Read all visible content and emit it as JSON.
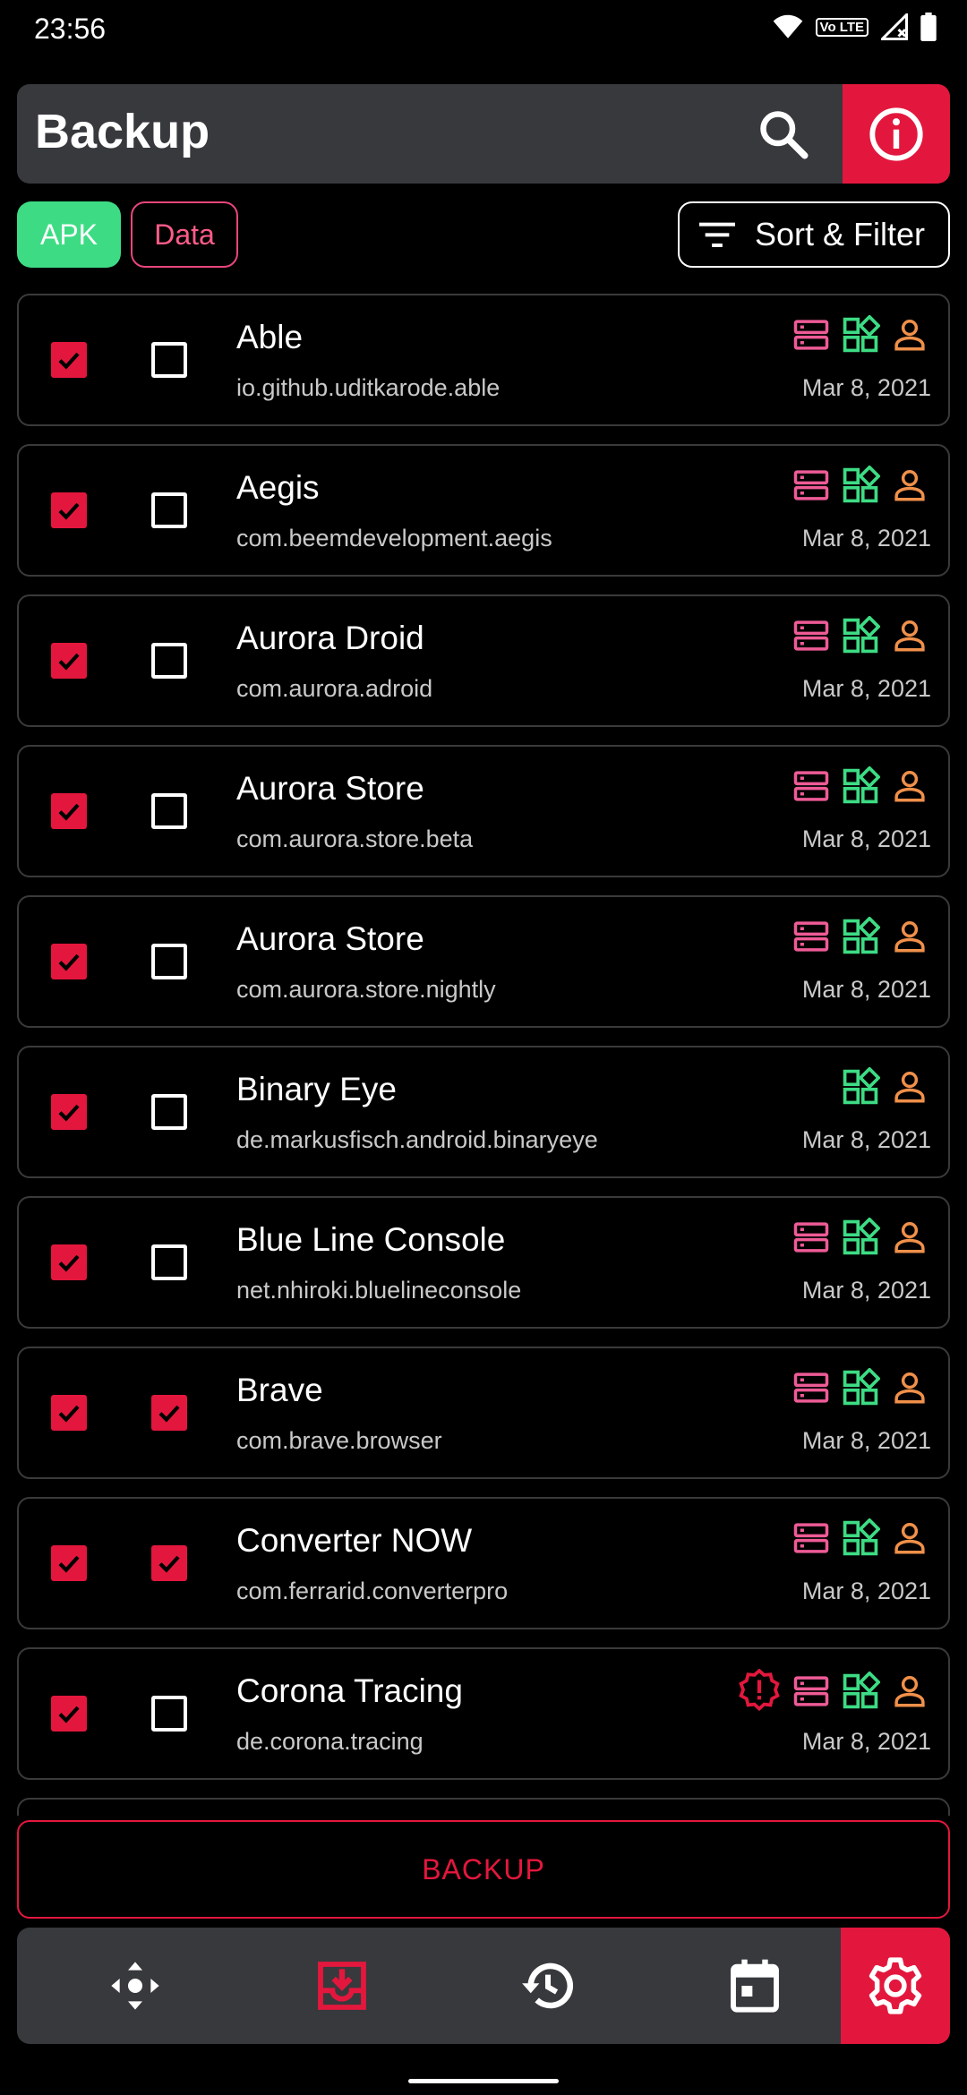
{
  "status_bar": {
    "time": "23:56",
    "volte": "Vo LTE"
  },
  "header": {
    "title": "Backup"
  },
  "chips": {
    "apk": "APK",
    "data": "Data"
  },
  "sort_filter": {
    "label": "Sort & Filter"
  },
  "colors": {
    "accent": "#e3173d",
    "green": "#3ddc84",
    "pink": "#ee5b96",
    "orange": "#f0904a"
  },
  "apps": [
    {
      "name": "Able",
      "package": "io.github.uditkarode.able",
      "date": "Mar 8, 2021",
      "apk": true,
      "data": false,
      "has_storage": true,
      "warning": false
    },
    {
      "name": "Aegis",
      "package": "com.beemdevelopment.aegis",
      "date": "Mar 8, 2021",
      "apk": true,
      "data": false,
      "has_storage": true,
      "warning": false
    },
    {
      "name": "Aurora Droid",
      "package": "com.aurora.adroid",
      "date": "Mar 8, 2021",
      "apk": true,
      "data": false,
      "has_storage": true,
      "warning": false
    },
    {
      "name": "Aurora Store",
      "package": "com.aurora.store.beta",
      "date": "Mar 8, 2021",
      "apk": true,
      "data": false,
      "has_storage": true,
      "warning": false
    },
    {
      "name": "Aurora Store",
      "package": "com.aurora.store.nightly",
      "date": "Mar 8, 2021",
      "apk": true,
      "data": false,
      "has_storage": true,
      "warning": false
    },
    {
      "name": "Binary Eye",
      "package": "de.markusfisch.android.binaryeye",
      "date": "Mar 8, 2021",
      "apk": true,
      "data": false,
      "has_storage": false,
      "warning": false
    },
    {
      "name": "Blue Line Console",
      "package": "net.nhiroki.bluelineconsole",
      "date": "Mar 8, 2021",
      "apk": true,
      "data": false,
      "has_storage": true,
      "warning": false
    },
    {
      "name": "Brave",
      "package": "com.brave.browser",
      "date": "Mar 8, 2021",
      "apk": true,
      "data": true,
      "has_storage": true,
      "warning": false
    },
    {
      "name": "Converter NOW",
      "package": "com.ferrarid.converterpro",
      "date": "Mar 8, 2021",
      "apk": true,
      "data": true,
      "has_storage": true,
      "warning": false
    },
    {
      "name": "Corona Tracing",
      "package": "de.corona.tracing",
      "date": "Mar 8, 2021",
      "apk": true,
      "data": false,
      "has_storage": true,
      "warning": true
    }
  ],
  "backup_button": {
    "label": "BACKUP"
  },
  "nav": {
    "items": [
      "home-icon",
      "backup-icon",
      "restore-icon",
      "schedule-icon",
      "settings-icon"
    ],
    "active": "settings-icon"
  }
}
